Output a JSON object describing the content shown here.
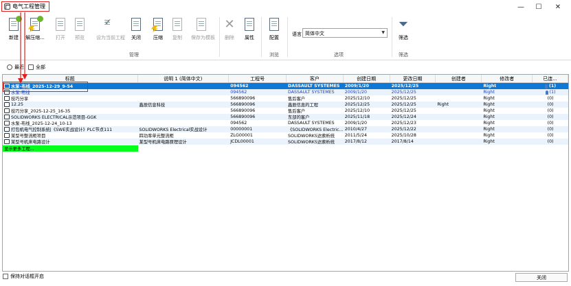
{
  "window": {
    "title": "电气工程管理",
    "minimize": "—",
    "maximize": "☐",
    "close": "✕"
  },
  "ribbon": {
    "buttons": [
      {
        "label": "新建",
        "icon": "new-project-icon",
        "enabled": true
      },
      {
        "label": "解压缩...",
        "icon": "unarchive-icon",
        "enabled": true
      },
      {
        "label": "打开",
        "icon": "open-icon",
        "enabled": false
      },
      {
        "label": "预览",
        "icon": "preview-icon",
        "enabled": false
      },
      {
        "label": "设为当前工程",
        "icon": "set-current-icon",
        "enabled": false
      },
      {
        "label": "关闭",
        "icon": "close-project-icon",
        "enabled": true
      },
      {
        "label": "压缩",
        "icon": "archive-icon",
        "enabled": true
      },
      {
        "label": "复制",
        "icon": "copy-icon",
        "enabled": false
      },
      {
        "label": "保存为模板",
        "icon": "save-template-icon",
        "enabled": false
      },
      {
        "label": "删除",
        "icon": "delete-icon",
        "enabled": false
      },
      {
        "label": "属性",
        "icon": "properties-icon",
        "enabled": true
      },
      {
        "label": "配置",
        "icon": "configure-icon",
        "enabled": true
      },
      {
        "label": "筛选",
        "icon": "filter-icon",
        "enabled": true
      }
    ],
    "groups": {
      "manage": "管理",
      "browse": "浏览",
      "options": "选项",
      "filter": "筛选"
    },
    "language_label": "语言",
    "language_value": "简体中文"
  },
  "filter": {
    "recent": "最近",
    "all": "全部"
  },
  "table": {
    "columns": [
      "标题",
      "说明 1 (简体中文)",
      "工程号",
      "客户",
      "创建日期",
      "更改日期",
      "创建者",
      "修改者",
      "已连..."
    ],
    "rows": [
      {
        "title": "水泵-布线_2025-12-29_9-54",
        "desc": "",
        "no": "094562",
        "customer": "DASSAULT SYSTEMES",
        "created": "2009/1/20",
        "modified": "2025/12/25",
        "creator": "",
        "modifier": "Right",
        "conn": "(1)",
        "person": true
      },
      {
        "title": "水泵-布线",
        "desc": "",
        "no": "094562",
        "customer": "DASSAULT SYSTEMES",
        "created": "2009/1/20",
        "modified": "2025/12/25",
        "creator": "",
        "modifier": "Right",
        "conn": "(1)",
        "person": true
      },
      {
        "title": "技巧分享",
        "desc": "",
        "no": "566890096",
        "customer": "售后客户",
        "created": "2025/12/10",
        "modified": "2025/12/25",
        "creator": "",
        "modifier": "Right",
        "conn": "(0)",
        "person": false
      },
      {
        "title": "12.25",
        "desc": "鑫辰信息科技",
        "no": "566890096",
        "customer": "鑫辰信息的工程",
        "created": "2025/12/25",
        "modified": "2025/12/25",
        "creator": "Right",
        "modifier": "Right",
        "conn": "(0)",
        "person": false
      },
      {
        "title": "技巧分享_2025-12-25_16-35",
        "desc": "",
        "no": "566890096",
        "customer": "售后客户",
        "created": "2025/12/10",
        "modified": "2025/12/25",
        "creator": "",
        "modifier": "Right",
        "conn": "(0)",
        "person": false
      },
      {
        "title": "SOLIDWORKS ELECTRICAL示范项目-GGK",
        "desc": "",
        "no": "566890096",
        "customer": "东部的客户",
        "created": "2025/11/18",
        "modified": "2025/12/24",
        "creator": "",
        "modifier": "Right",
        "conn": "(0)",
        "person": false
      },
      {
        "title": "水泵-布线_2025-12-24_10-13",
        "desc": "",
        "no": "094562",
        "customer": "DASSAULT SYSTEMES",
        "created": "2009/1/20",
        "modified": "2025/12/23",
        "creator": "",
        "modifier": "Right",
        "conn": "(0)",
        "person": false
      },
      {
        "title": "打包机电气控制系统|《SWE实战设计》PLC节点111",
        "desc": "SOLIDWORKS Electrical实战设计",
        "no": "00000001",
        "customer": "《SOLIDWORKS Electric...",
        "created": "2010/4/27",
        "modified": "2025/12/22",
        "creator": "",
        "modifier": "Right",
        "conn": "(0)",
        "person": false
      },
      {
        "title": "某型号整流柜项目",
        "desc": "四功率单元整流柜",
        "no": "ZLG00001",
        "customer": "SOLIDWORKS达索析统",
        "created": "2011/5/24",
        "modified": "2025/10/28",
        "creator": "",
        "modifier": "Right",
        "conn": "(0)",
        "person": false
      },
      {
        "title": "某型号机床电路设计",
        "desc": "某型号机床电路原理设计",
        "no": "JCDL00001",
        "customer": "SOLIDWORKS达索析统",
        "created": "2017/8/12",
        "modified": "2017/8/14",
        "creator": "",
        "modifier": "Right",
        "conn": "(0)",
        "person": false
      }
    ],
    "show_more": "显示更多工程..."
  },
  "footer": {
    "keep_open": "保持对话框开启",
    "close": "关闭"
  },
  "colors": {
    "selection": "#0f78d4",
    "highlight_green": "#00ff1a",
    "annotation_red": "#e02020"
  }
}
